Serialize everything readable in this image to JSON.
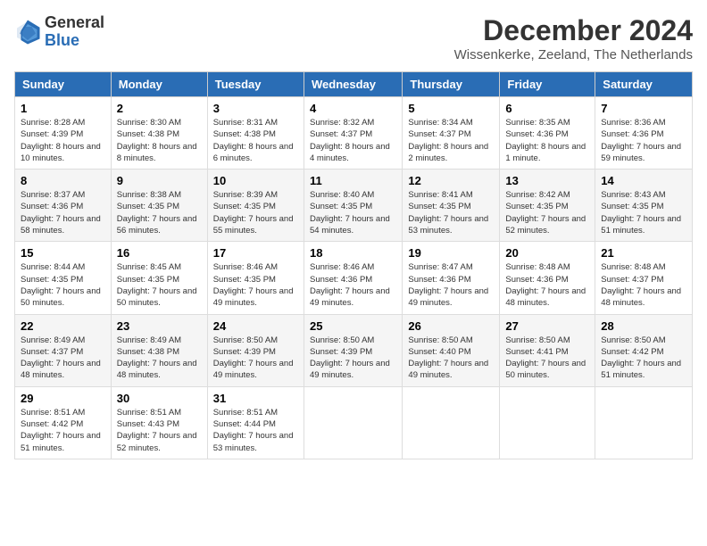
{
  "header": {
    "logo_general": "General",
    "logo_blue": "Blue",
    "month": "December 2024",
    "location": "Wissenkerke, Zeeland, The Netherlands"
  },
  "days_of_week": [
    "Sunday",
    "Monday",
    "Tuesday",
    "Wednesday",
    "Thursday",
    "Friday",
    "Saturday"
  ],
  "weeks": [
    [
      {
        "day": "1",
        "sunrise": "8:28 AM",
        "sunset": "4:39 PM",
        "daylight": "8 hours and 10 minutes."
      },
      {
        "day": "2",
        "sunrise": "8:30 AM",
        "sunset": "4:38 PM",
        "daylight": "8 hours and 8 minutes."
      },
      {
        "day": "3",
        "sunrise": "8:31 AM",
        "sunset": "4:38 PM",
        "daylight": "8 hours and 6 minutes."
      },
      {
        "day": "4",
        "sunrise": "8:32 AM",
        "sunset": "4:37 PM",
        "daylight": "8 hours and 4 minutes."
      },
      {
        "day": "5",
        "sunrise": "8:34 AM",
        "sunset": "4:37 PM",
        "daylight": "8 hours and 2 minutes."
      },
      {
        "day": "6",
        "sunrise": "8:35 AM",
        "sunset": "4:36 PM",
        "daylight": "8 hours and 1 minute."
      },
      {
        "day": "7",
        "sunrise": "8:36 AM",
        "sunset": "4:36 PM",
        "daylight": "7 hours and 59 minutes."
      }
    ],
    [
      {
        "day": "8",
        "sunrise": "8:37 AM",
        "sunset": "4:36 PM",
        "daylight": "7 hours and 58 minutes."
      },
      {
        "day": "9",
        "sunrise": "8:38 AM",
        "sunset": "4:35 PM",
        "daylight": "7 hours and 56 minutes."
      },
      {
        "day": "10",
        "sunrise": "8:39 AM",
        "sunset": "4:35 PM",
        "daylight": "7 hours and 55 minutes."
      },
      {
        "day": "11",
        "sunrise": "8:40 AM",
        "sunset": "4:35 PM",
        "daylight": "7 hours and 54 minutes."
      },
      {
        "day": "12",
        "sunrise": "8:41 AM",
        "sunset": "4:35 PM",
        "daylight": "7 hours and 53 minutes."
      },
      {
        "day": "13",
        "sunrise": "8:42 AM",
        "sunset": "4:35 PM",
        "daylight": "7 hours and 52 minutes."
      },
      {
        "day": "14",
        "sunrise": "8:43 AM",
        "sunset": "4:35 PM",
        "daylight": "7 hours and 51 minutes."
      }
    ],
    [
      {
        "day": "15",
        "sunrise": "8:44 AM",
        "sunset": "4:35 PM",
        "daylight": "7 hours and 50 minutes."
      },
      {
        "day": "16",
        "sunrise": "8:45 AM",
        "sunset": "4:35 PM",
        "daylight": "7 hours and 50 minutes."
      },
      {
        "day": "17",
        "sunrise": "8:46 AM",
        "sunset": "4:35 PM",
        "daylight": "7 hours and 49 minutes."
      },
      {
        "day": "18",
        "sunrise": "8:46 AM",
        "sunset": "4:36 PM",
        "daylight": "7 hours and 49 minutes."
      },
      {
        "day": "19",
        "sunrise": "8:47 AM",
        "sunset": "4:36 PM",
        "daylight": "7 hours and 49 minutes."
      },
      {
        "day": "20",
        "sunrise": "8:48 AM",
        "sunset": "4:36 PM",
        "daylight": "7 hours and 48 minutes."
      },
      {
        "day": "21",
        "sunrise": "8:48 AM",
        "sunset": "4:37 PM",
        "daylight": "7 hours and 48 minutes."
      }
    ],
    [
      {
        "day": "22",
        "sunrise": "8:49 AM",
        "sunset": "4:37 PM",
        "daylight": "7 hours and 48 minutes."
      },
      {
        "day": "23",
        "sunrise": "8:49 AM",
        "sunset": "4:38 PM",
        "daylight": "7 hours and 48 minutes."
      },
      {
        "day": "24",
        "sunrise": "8:50 AM",
        "sunset": "4:39 PM",
        "daylight": "7 hours and 49 minutes."
      },
      {
        "day": "25",
        "sunrise": "8:50 AM",
        "sunset": "4:39 PM",
        "daylight": "7 hours and 49 minutes."
      },
      {
        "day": "26",
        "sunrise": "8:50 AM",
        "sunset": "4:40 PM",
        "daylight": "7 hours and 49 minutes."
      },
      {
        "day": "27",
        "sunrise": "8:50 AM",
        "sunset": "4:41 PM",
        "daylight": "7 hours and 50 minutes."
      },
      {
        "day": "28",
        "sunrise": "8:50 AM",
        "sunset": "4:42 PM",
        "daylight": "7 hours and 51 minutes."
      }
    ],
    [
      {
        "day": "29",
        "sunrise": "8:51 AM",
        "sunset": "4:42 PM",
        "daylight": "7 hours and 51 minutes."
      },
      {
        "day": "30",
        "sunrise": "8:51 AM",
        "sunset": "4:43 PM",
        "daylight": "7 hours and 52 minutes."
      },
      {
        "day": "31",
        "sunrise": "8:51 AM",
        "sunset": "4:44 PM",
        "daylight": "7 hours and 53 minutes."
      },
      null,
      null,
      null,
      null
    ]
  ]
}
